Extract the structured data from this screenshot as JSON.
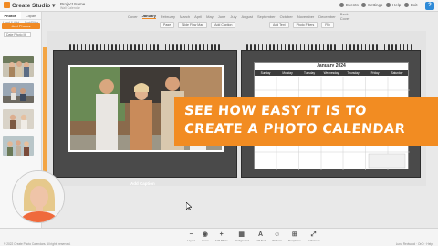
{
  "topbar": {
    "app_title": "Create Studio",
    "project_label": "Project Name",
    "project_sub": "Wall Calendar",
    "events_label": "Events",
    "settings_label": "Settings",
    "help_label": "Help",
    "exit_label": "Exit",
    "help_badge": "?"
  },
  "sidebar": {
    "tabs": [
      "Photos",
      "Clipart"
    ],
    "options": [
      "Load & Add",
      "Sort/Filter",
      "Unload",
      "Refresh"
    ],
    "add_photos_label": "Add Photos",
    "sort_label": "Date Photo M"
  },
  "months": [
    "Cover",
    "January",
    "February",
    "March",
    "April",
    "May",
    "June",
    "July",
    "August",
    "September",
    "October",
    "November",
    "December",
    "Back Cover"
  ],
  "active_month": "January",
  "toolbar_left": [
    "Page",
    "Slide Flow Map",
    "Add Caption"
  ],
  "toolbar_right": [
    "Add Text",
    "Photo Filters",
    "Flip"
  ],
  "calendar": {
    "title": "January 2024",
    "days": [
      "Sunday",
      "Monday",
      "Tuesday",
      "Wednesday",
      "Thursday",
      "Friday",
      "Saturday"
    ],
    "caption": "Add Caption"
  },
  "banner": {
    "line1": "SEE HOW EASY IT IS TO",
    "line2": "CREATE A PHOTO CALENDAR"
  },
  "bottom_tools": [
    {
      "icon": "−",
      "label": "Layout"
    },
    {
      "icon": "◉",
      "label": "Zoom"
    },
    {
      "icon": "+",
      "label": "Add Photo"
    },
    {
      "icon": "▦",
      "label": "Background"
    },
    {
      "icon": "A",
      "label": "Add Text"
    },
    {
      "icon": "☺",
      "label": "Stickers"
    },
    {
      "icon": "⊞",
      "label": "Templates"
    },
    {
      "icon": "⤢",
      "label": "Fullscreen"
    }
  ],
  "footer": {
    "copyright": "© 2022 Create Photo Calendars. All rights reserved.",
    "right": "Luna Redwood · OnD · Help"
  },
  "colors": {
    "accent": "#f28c22",
    "page_dark": "#4a4a4a",
    "header_bg": "#f4f4f4"
  }
}
